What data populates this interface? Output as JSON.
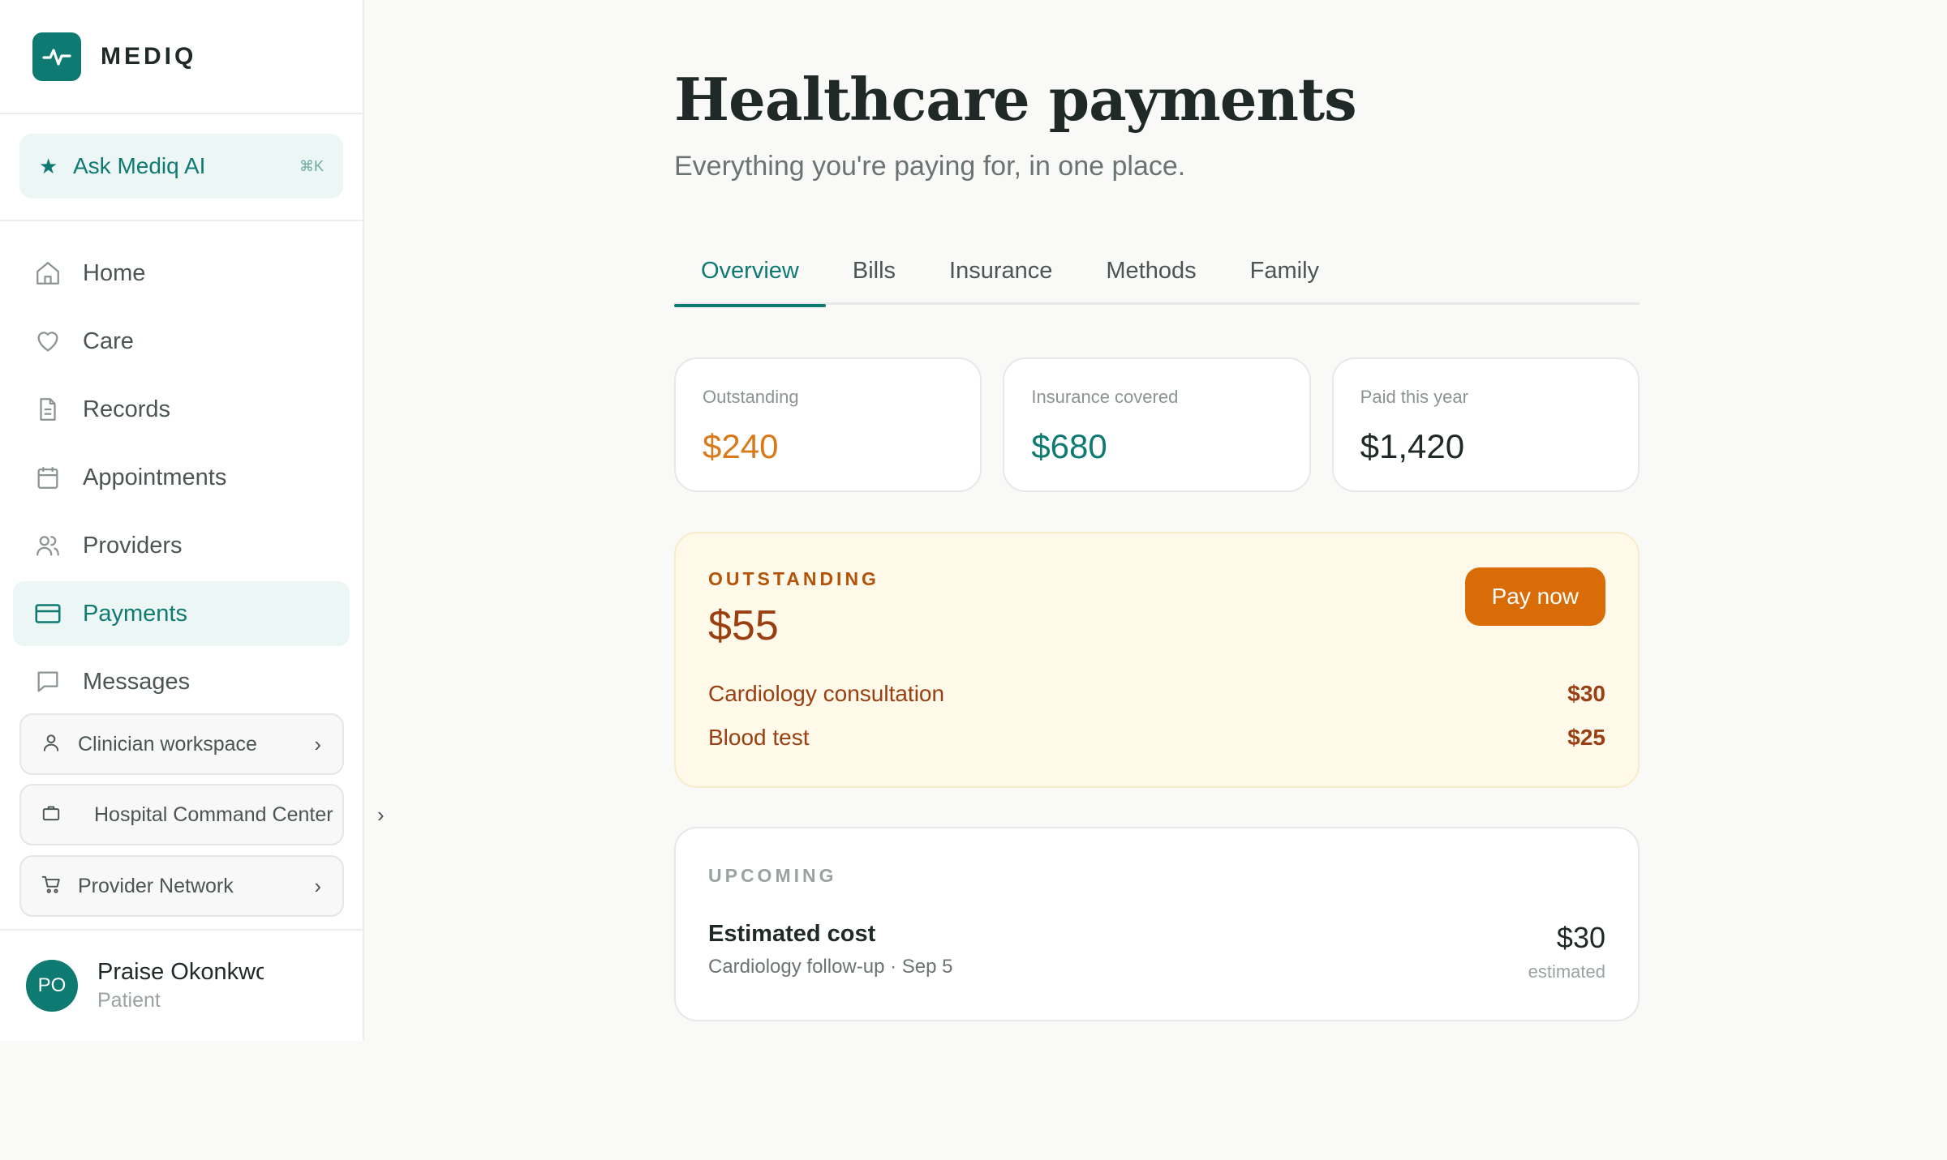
{
  "brand": {
    "name": "MEDIQ"
  },
  "ask": {
    "label": "Ask Mediq AI",
    "shortcut": "⌘K"
  },
  "nav": [
    {
      "label": "Home",
      "icon": "home-icon"
    },
    {
      "label": "Care",
      "icon": "heart-icon"
    },
    {
      "label": "Records",
      "icon": "document-icon"
    },
    {
      "label": "Appointments",
      "icon": "calendar-icon"
    },
    {
      "label": "Providers",
      "icon": "users-icon"
    },
    {
      "label": "Payments",
      "icon": "credit-card-icon",
      "active": true
    },
    {
      "label": "Messages",
      "icon": "message-icon"
    }
  ],
  "workspaces": [
    {
      "label": "Clinician workspace",
      "icon": "person-icon"
    },
    {
      "label": "Hospital Command Center",
      "icon": "briefcase-icon"
    },
    {
      "label": "Provider Network",
      "icon": "cart-icon"
    }
  ],
  "user": {
    "initials": "PO",
    "name": "Praise Okonkwo",
    "role": "Patient"
  },
  "page": {
    "title": "Healthcare payments",
    "subtitle": "Everything you're paying for, in one place."
  },
  "tabs": [
    "Overview",
    "Bills",
    "Insurance",
    "Methods",
    "Family"
  ],
  "stats": [
    {
      "label": "Outstanding",
      "value": "$240",
      "color": "#d97a1a"
    },
    {
      "label": "Insurance covered",
      "value": "$680",
      "color": "#0f7a72"
    },
    {
      "label": "Paid this year",
      "value": "$1,420",
      "color": "#1f2a28"
    }
  ],
  "outstanding": {
    "label": "OUTSTANDING",
    "amount": "$55",
    "pay_label": "Pay now",
    "items": [
      {
        "name": "Cardiology consultation",
        "amount": "$30"
      },
      {
        "name": "Blood test",
        "amount": "$25"
      }
    ]
  },
  "upcoming": {
    "label": "UPCOMING",
    "title": "Estimated cost",
    "detail": "Cardiology follow-up · Sep 5",
    "amount": "$30",
    "note": "estimated"
  },
  "colors": {
    "accent": "#0f7a72",
    "warning": "#d96c06",
    "warning_text": "#9a3f12"
  }
}
